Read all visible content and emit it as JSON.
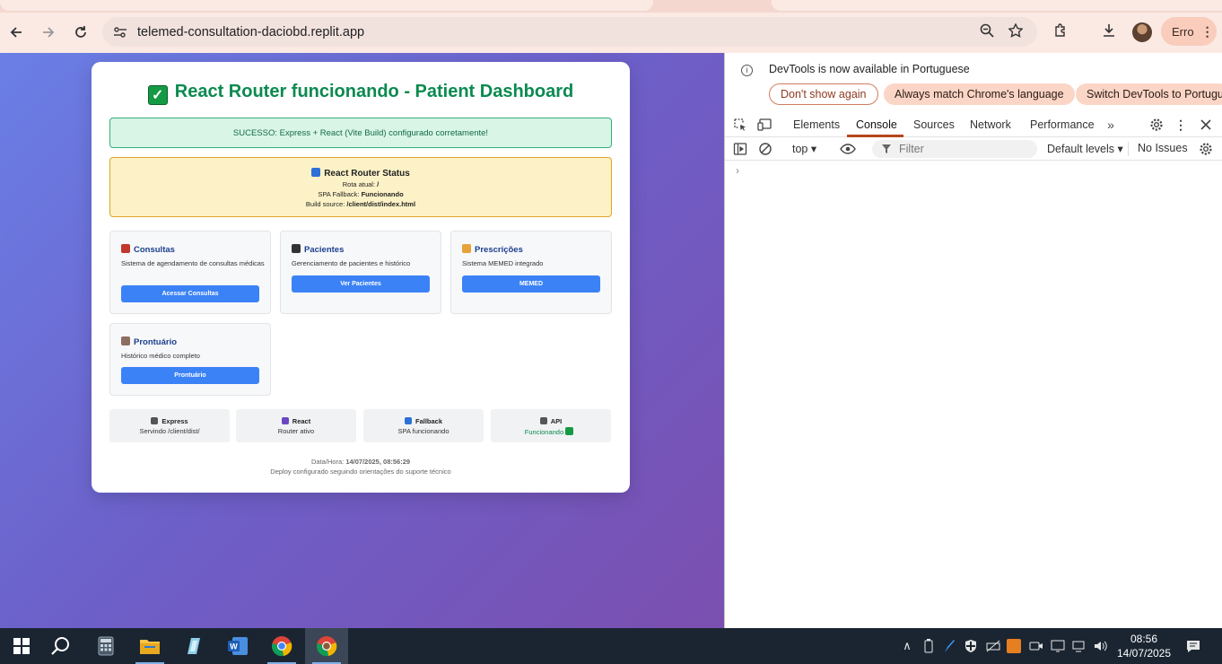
{
  "browser": {
    "url": "telemed-consultation-daciobd.replit.app",
    "profile_chip": "Erro"
  },
  "page": {
    "title": "React Router funcionando - Patient Dashboard",
    "success_message": "SUCESSO: Express + React (Vite Build) configurado corretamente!",
    "router_status": {
      "title": "React Router Status",
      "route_label": "Rota atual:",
      "route_value": "/",
      "fallback_label": "SPA Fallback:",
      "fallback_value": "Funcionando",
      "build_label": "Build source:",
      "build_value": "/client/dist/index.html"
    },
    "features": [
      {
        "title": "Consultas",
        "desc": "Sistema de agendamento de consultas médicas",
        "button": "Acessar Consultas"
      },
      {
        "title": "Pacientes",
        "desc": "Gerenciamento de pacientes e histórico",
        "button": "Ver Pacientes"
      },
      {
        "title": "Prescrições",
        "desc": "Sistema MEMED integrado",
        "button": "MEMED"
      },
      {
        "title": "Prontuário",
        "desc": "Histórico médico completo",
        "button": "Prontuário"
      }
    ],
    "stats": [
      {
        "title": "Express",
        "sub": "Servindo /client/dist/"
      },
      {
        "title": "React",
        "sub": "Router ativo"
      },
      {
        "title": "Fallback",
        "sub": "SPA funcionando"
      },
      {
        "title": "API",
        "sub": "Funcionando"
      }
    ],
    "footer": {
      "datetime_label": "Data/Hora:",
      "datetime_value": "14/07/2025, 08:56:29",
      "deploy_note": "Deploy configurado seguindo orientações do suporte técnico"
    }
  },
  "devtools": {
    "info_message": "DevTools is now available in Portuguese",
    "buttons": [
      "Don't show again",
      "Always match Chrome's language",
      "Switch DevTools to Portugue"
    ],
    "tabs": [
      "Elements",
      "Console",
      "Sources",
      "Network",
      "Performance"
    ],
    "active_tab": "Console",
    "context": "top",
    "filter_placeholder": "Filter",
    "levels": "Default levels",
    "issues": "No Issues"
  },
  "taskbar": {
    "time": "08:56",
    "date": "14/07/2025"
  },
  "colors": {
    "title_green": "#0a8a4f",
    "button_blue": "#3b82f6",
    "devtools_accent": "#b5461b"
  }
}
